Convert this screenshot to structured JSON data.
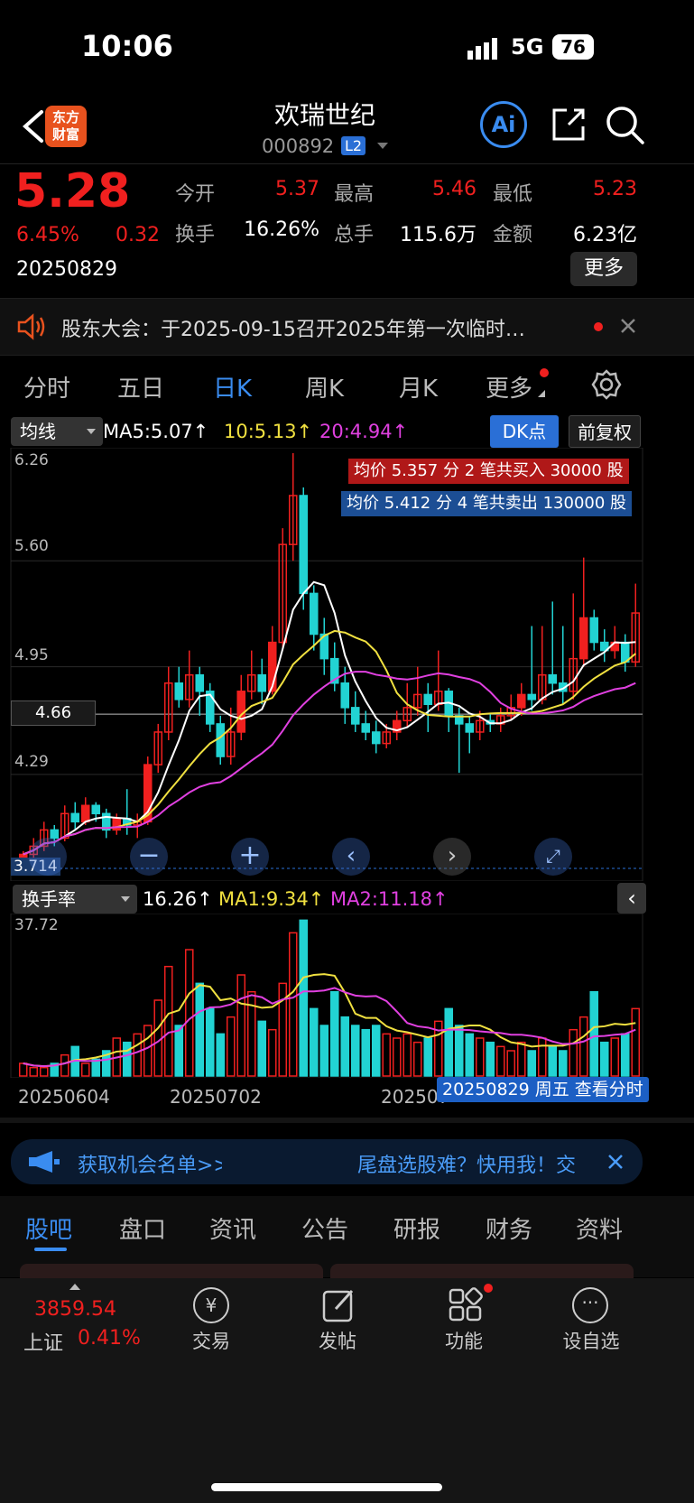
{
  "status_bar": {
    "time": "10:06",
    "network": "5G",
    "battery": "76"
  },
  "header": {
    "title": "欢瑞世纪",
    "code": "000892",
    "level_badge": "L2",
    "logo_line1": "东方",
    "logo_line2": "财富",
    "ai_label": "Ai"
  },
  "quote": {
    "price": "5.28",
    "change_pct": "6.45%",
    "change_abs": "0.32",
    "date": "20250829",
    "open_label": "今开",
    "open": "5.37",
    "high_label": "最高",
    "high": "5.46",
    "low_label": "最低",
    "low": "5.23",
    "turnover_label": "换手",
    "turnover": "16.26%",
    "volume_label": "总手",
    "volume": "115.6万",
    "amount_label": "金额",
    "amount": "6.23亿",
    "more_button": "更多"
  },
  "notice": {
    "text": "股东大会：于2025-09-15召开2025年第一次临时…"
  },
  "period_tabs": {
    "t1": "分时",
    "t2": "五日",
    "t3": "日K",
    "t4": "周K",
    "t5": "月K",
    "t6": "更多"
  },
  "chart_controls": {
    "indicator": "均线",
    "ma5": "MA5:5.07↑",
    "ma10": "10:5.13↑",
    "ma20": "20:4.94↑",
    "dk_button": "DK点",
    "adjust_button": "前复权"
  },
  "chart_banner": {
    "buy": "均价 5.357 分 2 笔共买入 30000 股",
    "sell": "均价 5.412 分 4 笔共卖出 130000 股"
  },
  "price_axis": {
    "y1": "6.26",
    "y2": "5.60",
    "y3": "4.95",
    "crosshair": "4.66",
    "y4": "4.29",
    "y5": "3.714"
  },
  "turnover_controls": {
    "indicator": "换手率",
    "value": "16.26↑",
    "ma1": "MA1:9.34↑",
    "ma2": "MA2:11.18↑",
    "axis_max": "37.72"
  },
  "date_axis": {
    "d1": "20250604",
    "d2": "20250702",
    "d3": "20250731"
  },
  "date_popup": "20250829 周五 查看分时",
  "ad": {
    "left": "获取机会名单>>",
    "right": "尾盘选股难？快用我！交"
  },
  "bottom_tabs": {
    "b1": "股吧",
    "b2": "盘口",
    "b3": "资讯",
    "b4": "公告",
    "b5": "研报",
    "b6": "财务",
    "b7": "资料"
  },
  "nav": {
    "index_value": "3859.54",
    "index_name": "上证",
    "index_change": "0.41%",
    "n1": "交易",
    "n2": "发帖",
    "n3": "功能",
    "n4": "设自选"
  },
  "colors": {
    "up": "#f0201f",
    "down": "#22d3d3",
    "ma5": "#ffffff",
    "ma10": "#f0e040",
    "ma20": "#e040e0",
    "accent": "#3a8cf0"
  },
  "chart_data": {
    "type": "candlestick",
    "candles": [
      [
        3.78,
        3.8,
        3.72,
        3.82
      ],
      [
        3.8,
        3.85,
        3.78,
        3.9
      ],
      [
        3.85,
        3.95,
        3.82,
        4.0
      ],
      [
        3.95,
        3.9,
        3.85,
        3.98
      ],
      [
        3.9,
        4.05,
        3.88,
        4.1
      ],
      [
        4.05,
        4.0,
        3.95,
        4.12
      ],
      [
        4.0,
        4.1,
        3.98,
        4.15
      ],
      [
        4.1,
        4.05,
        4.0,
        4.12
      ],
      [
        4.05,
        3.95,
        3.9,
        4.08
      ],
      [
        3.95,
        4.02,
        3.92,
        4.05
      ],
      [
        4.02,
        3.98,
        3.92,
        4.2
      ],
      [
        3.98,
        4.0,
        3.9,
        4.05
      ],
      [
        4.0,
        4.35,
        3.98,
        4.4
      ],
      [
        4.35,
        4.55,
        4.3,
        4.6
      ],
      [
        4.55,
        4.85,
        4.5,
        4.95
      ],
      [
        4.85,
        4.75,
        4.7,
        4.95
      ],
      [
        4.75,
        4.9,
        4.7,
        5.05
      ],
      [
        4.9,
        4.8,
        4.65,
        4.95
      ],
      [
        4.8,
        4.6,
        4.55,
        4.85
      ],
      [
        4.6,
        4.4,
        4.35,
        4.65
      ],
      [
        4.4,
        4.55,
        4.35,
        4.7
      ],
      [
        4.55,
        4.8,
        4.5,
        4.9
      ],
      [
        4.8,
        4.9,
        4.75,
        5.05
      ],
      [
        4.9,
        4.8,
        4.72,
        5.0
      ],
      [
        4.8,
        5.1,
        4.78,
        5.2
      ],
      [
        5.1,
        5.7,
        5.05,
        5.8
      ],
      [
        5.7,
        6.0,
        5.6,
        6.26
      ],
      [
        6.0,
        5.4,
        5.3,
        6.05
      ],
      [
        5.4,
        5.15,
        5.05,
        5.45
      ],
      [
        5.15,
        5.0,
        4.9,
        5.25
      ],
      [
        5.0,
        4.85,
        4.8,
        5.1
      ],
      [
        4.85,
        4.7,
        4.6,
        4.95
      ],
      [
        4.7,
        4.6,
        4.55,
        4.8
      ],
      [
        4.6,
        4.55,
        4.5,
        4.68
      ],
      [
        4.55,
        4.48,
        4.42,
        4.62
      ],
      [
        4.48,
        4.55,
        4.45,
        4.6
      ],
      [
        4.55,
        4.62,
        4.5,
        4.68
      ],
      [
        4.62,
        4.7,
        4.58,
        4.85
      ],
      [
        4.7,
        4.78,
        4.65,
        4.95
      ],
      [
        4.78,
        4.72,
        4.55,
        4.85
      ],
      [
        4.72,
        4.8,
        4.68,
        5.05
      ],
      [
        4.8,
        4.65,
        4.55,
        4.82
      ],
      [
        4.65,
        4.6,
        4.3,
        4.7
      ],
      [
        4.6,
        4.55,
        4.42,
        4.65
      ],
      [
        4.55,
        4.62,
        4.5,
        4.68
      ],
      [
        4.62,
        4.6,
        4.55,
        4.66
      ],
      [
        4.6,
        4.65,
        4.55,
        4.7
      ],
      [
        4.65,
        4.7,
        4.62,
        4.78
      ],
      [
        4.7,
        4.78,
        4.65,
        4.85
      ],
      [
        4.78,
        4.75,
        4.68,
        5.2
      ],
      [
        4.75,
        4.9,
        4.72,
        5.2
      ],
      [
        4.9,
        4.85,
        4.78,
        5.35
      ],
      [
        4.85,
        4.8,
        4.72,
        5.2
      ],
      [
        4.8,
        5.0,
        4.75,
        5.4
      ],
      [
        5.0,
        5.25,
        4.95,
        5.62
      ],
      [
        5.25,
        5.1,
        5.05,
        5.3
      ],
      [
        5.1,
        5.05,
        4.98,
        5.18
      ],
      [
        5.05,
        5.1,
        5.0,
        5.2
      ],
      [
        5.1,
        4.98,
        4.92,
        5.15
      ],
      [
        4.98,
        5.28,
        4.95,
        5.46
      ]
    ],
    "turnover": [
      3,
      2,
      2,
      3,
      5,
      7,
      3,
      4,
      6,
      9,
      8,
      10,
      12,
      18,
      26,
      12,
      30,
      22,
      16,
      10,
      14,
      24,
      20,
      13,
      11,
      22,
      34,
      37,
      16,
      12,
      20,
      14,
      12,
      11,
      12,
      10,
      9,
      10,
      8,
      9,
      13,
      16,
      12,
      10,
      9,
      8,
      7,
      6,
      8,
      6,
      9,
      7,
      6,
      11,
      14,
      20,
      8,
      9,
      10,
      16
    ],
    "ylim": [
      3.714,
      6.26
    ],
    "turnover_ylim": [
      0,
      37.72
    ]
  }
}
